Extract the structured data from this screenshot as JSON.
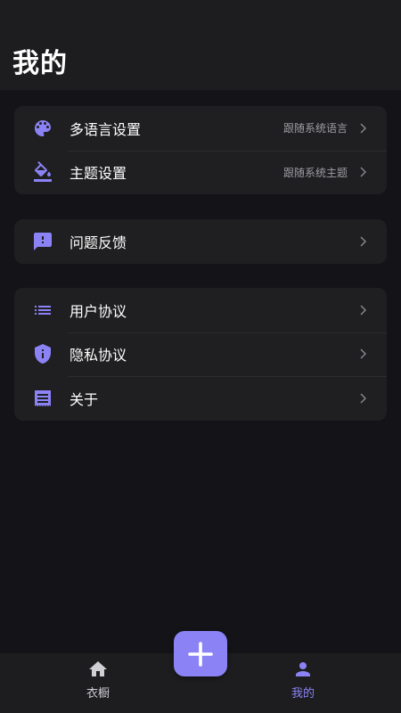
{
  "header": {
    "title": "我的"
  },
  "colors": {
    "accent": "#8b83f5",
    "muted": "#9c9ca3",
    "card": "#1f1f21"
  },
  "groups": [
    {
      "items": [
        {
          "icon": "palette-icon",
          "label": "多语言设置",
          "value": "跟随系统语言"
        },
        {
          "icon": "paint-bucket-icon",
          "label": "主题设置",
          "value": "跟随系统主题"
        }
      ]
    },
    {
      "items": [
        {
          "icon": "feedback-icon",
          "label": "问题反馈"
        }
      ]
    },
    {
      "items": [
        {
          "icon": "list-icon",
          "label": "用户协议"
        },
        {
          "icon": "shield-info-icon",
          "label": "隐私协议"
        },
        {
          "icon": "receipt-icon",
          "label": "关于"
        }
      ]
    }
  ],
  "tabbar": {
    "tabs": [
      {
        "icon": "home-icon",
        "label": "衣橱",
        "active": false
      },
      {
        "icon": "person-icon",
        "label": "我的",
        "active": true
      }
    ],
    "add_icon": "plus-icon"
  }
}
